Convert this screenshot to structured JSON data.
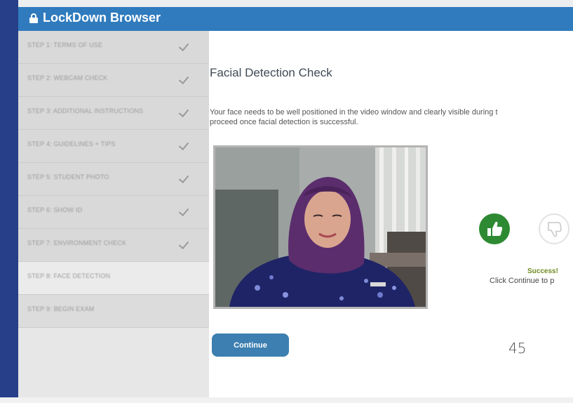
{
  "app": {
    "title": "LockDown Browser",
    "icons": {
      "title": "lock-icon"
    }
  },
  "sidebar": {
    "steps": [
      {
        "label": "STEP 1: TERMS OF USE",
        "completed": true
      },
      {
        "label": "STEP 2: WEBCAM CHECK",
        "completed": true
      },
      {
        "label": "STEP 3: ADDITIONAL INSTRUCTIONS",
        "completed": true
      },
      {
        "label": "STEP 4: GUIDELINES + TIPS",
        "completed": true
      },
      {
        "label": "STEP 5: STUDENT PHOTO",
        "completed": true
      },
      {
        "label": "STEP 6: SHOW ID",
        "completed": true
      },
      {
        "label": "STEP 7: ENVIRONMENT CHECK",
        "completed": true
      },
      {
        "label": "STEP 8: FACE DETECTION",
        "completed": false,
        "current": true
      },
      {
        "label": "STEP 9: BEGIN EXAM",
        "completed": false
      }
    ]
  },
  "main": {
    "heading": "Facial Detection Check",
    "instructions_line1": "Your face needs to be well positioned in the video window and clearly visible during t",
    "instructions_line2": "proceed once facial detection is successful.",
    "status_title": "Success!",
    "status_hint": "Click Continue to p",
    "continue_label": "Continue",
    "icons": {
      "positive": "thumbs-up-icon",
      "negative": "thumbs-down-icon"
    }
  },
  "overlay": {
    "page_number": "45"
  },
  "colors": {
    "titlebar": "#2f7bbd",
    "bezel": "#263f88",
    "success_green": "#2e8a32",
    "success_text": "#6e8a1f",
    "button": "#3d7fb0"
  }
}
